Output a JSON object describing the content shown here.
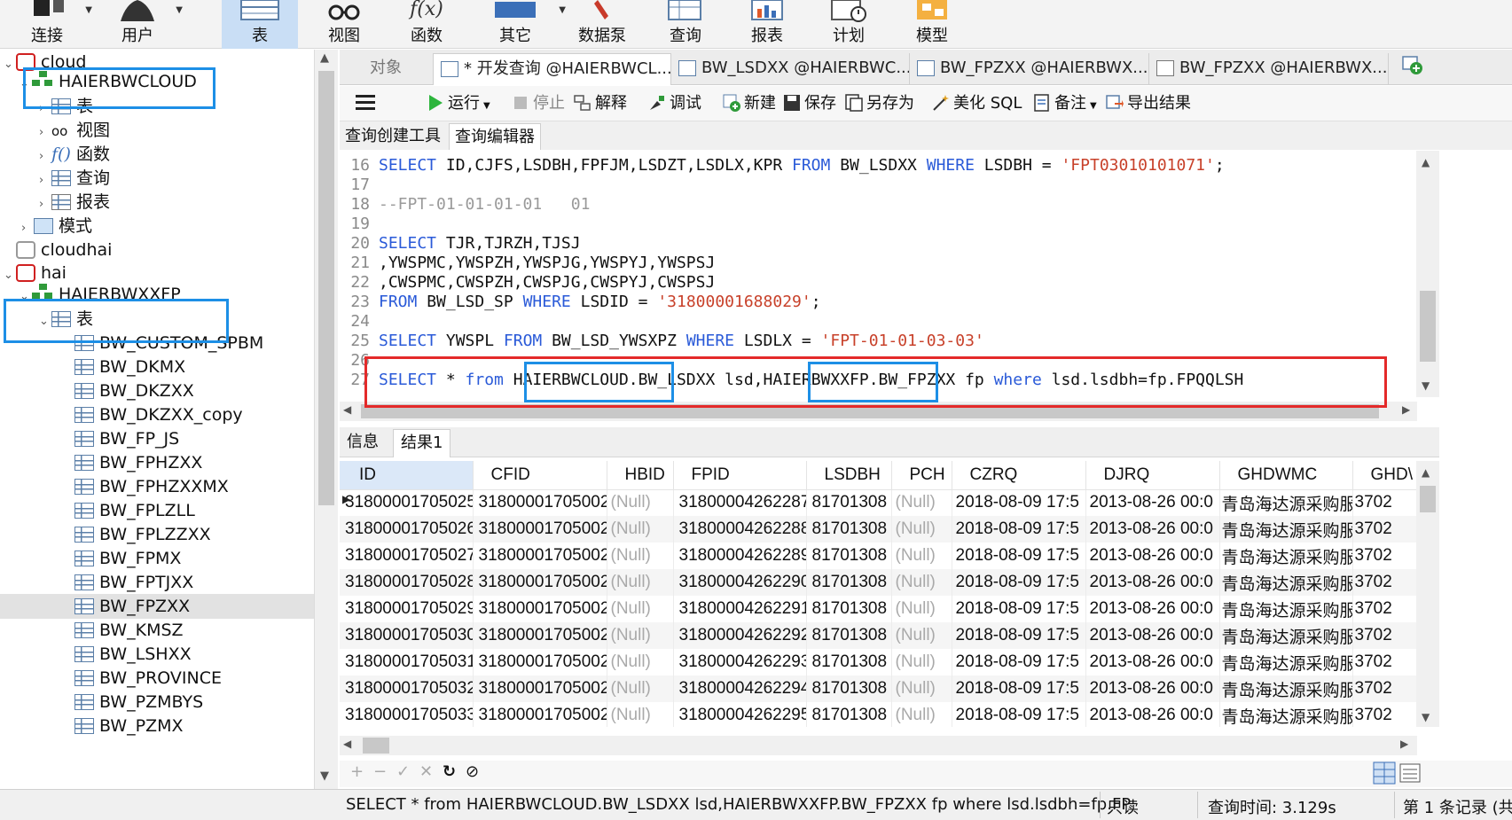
{
  "ribbon": {
    "buttons": [
      {
        "label": "连接",
        "icon": "plug-icon"
      },
      {
        "label": "用户",
        "icon": "user-icon"
      },
      {
        "label": "表",
        "icon": "table-icon"
      },
      {
        "label": "视图",
        "icon": "glasses-icon"
      },
      {
        "label": "函数",
        "icon": "function-icon"
      },
      {
        "label": "其它",
        "icon": "tools-icon"
      },
      {
        "label": "数据泵",
        "icon": "pump-icon"
      },
      {
        "label": "查询",
        "icon": "query-icon"
      },
      {
        "label": "报表",
        "icon": "report-icon"
      },
      {
        "label": "计划",
        "icon": "schedule-icon"
      },
      {
        "label": "模型",
        "icon": "model-icon"
      }
    ]
  },
  "tree": {
    "conn1": "cloud",
    "schema1": "HAIERBWCLOUD",
    "s1_items": [
      "表",
      "视图",
      "函数",
      "查询",
      "报表"
    ],
    "mode": "模式",
    "conn2": "cloudhai",
    "conn3": "hai",
    "schema2": "HAIERBWXXFP",
    "s2_table_folder": "表",
    "tables": [
      "BW_CUSTOM_SPBM",
      "BW_DKMX",
      "BW_DKZXX",
      "BW_DKZXX_copy",
      "BW_FP_JS",
      "BW_FPHZXX",
      "BW_FPHZXXMX",
      "BW_FPLZLL",
      "BW_FPLZZXX",
      "BW_FPMX",
      "BW_FPTJXX",
      "BW_FPZXX",
      "BW_KMSZ",
      "BW_LSHXX",
      "BW_PROVINCE",
      "BW_PZMBYS",
      "BW_PZMX"
    ],
    "selected_table": "BW_FPZXX"
  },
  "tabs": {
    "object": "对象",
    "items": [
      "* 开发查询 @HAIERBWCL...",
      "BW_LSDXX @HAIERBWC...",
      "BW_FPZXX @HAIERBWX...",
      "BW_FPZXX @HAIERBWX..."
    ]
  },
  "toolbar": {
    "run": "运行",
    "stop": "停止",
    "explain": "解释",
    "debug": "调试",
    "new": "新建",
    "save": "保存",
    "save_as": "另存为",
    "beautify": "美化 SQL",
    "comment": "备注",
    "export": "导出结果"
  },
  "subtabs": [
    "查询创建工具",
    "查询编辑器"
  ],
  "editor": {
    "l16": {
      "n": "16",
      "kw1": "SELECT",
      "a": " ID,CJFS,LSDBH,FPFJM,LSDZT,LSDLX,KPR ",
      "kw2": "FROM",
      "b": " BW_LSDXX ",
      "kw3": "WHERE",
      "c": " LSDBH = ",
      "s": "'FPT03010101071'",
      "d": ";"
    },
    "l17": {
      "n": "17"
    },
    "l18": {
      "n": "18",
      "cmt": "--FPT-01-01-01-01   01"
    },
    "l19": {
      "n": "19"
    },
    "l20": {
      "n": "20",
      "kw1": "SELECT",
      "a": " TJR,TJRZH,TJSJ"
    },
    "l21": {
      "n": "21",
      "a": ",YWSPMC,YWSPZH,YWSPJG,YWSPYJ,YWSPSJ"
    },
    "l22": {
      "n": "22",
      "a": ",CWSPMC,CWSPZH,CWSPJG,CWSPYJ,CWSPSJ"
    },
    "l23": {
      "n": "23",
      "kw1": "FROM",
      "a": " BW_LSD_SP ",
      "kw2": "WHERE",
      "b": " LSDID = ",
      "s": "'31800001688029'",
      "c": ";"
    },
    "l24": {
      "n": "24"
    },
    "l25": {
      "n": "25",
      "kw1": "SELECT",
      "a": " YWSPL ",
      "kw2": "FROM",
      "b": " BW_LSD_YWSXPZ ",
      "kw3": "WHERE",
      "c": " LSDLX = ",
      "s": "'FPT-01-01-03-03'"
    },
    "l26": {
      "n": "26"
    },
    "l27": {
      "n": "27",
      "kw1": "SELECT",
      "a": " * ",
      "kw2": "from",
      "b": " HAIERBWCLOUD.BW_LSDXX lsd,HAIERBWXXFP.BW_FPZXX fp ",
      "kw3": "where",
      "c": " lsd.lsdbh=fp.FPQQLSH"
    }
  },
  "result_tabs": [
    "信息",
    "结果1"
  ],
  "grid": {
    "columns": [
      "ID",
      "CFID",
      "HBID",
      "FPID",
      "LSDBH",
      "PCH",
      "CZRQ",
      "DJRQ",
      "GHDWMC",
      "GHD\\"
    ],
    "rows": [
      [
        "31800001705025",
        "31800001705002",
        "(Null)",
        "31800004262287",
        "81701308",
        "(Null)",
        "2018-08-09 17:5",
        "2013-08-26 00:0",
        "青岛海达源采购服",
        "3702"
      ],
      [
        "31800001705026",
        "31800001705002",
        "(Null)",
        "31800004262288",
        "81701308",
        "(Null)",
        "2018-08-09 17:5",
        "2013-08-26 00:0",
        "青岛海达源采购服",
        "3702"
      ],
      [
        "31800001705027",
        "31800001705002",
        "(Null)",
        "31800004262289",
        "81701308",
        "(Null)",
        "2018-08-09 17:5",
        "2013-08-26 00:0",
        "青岛海达源采购服",
        "3702"
      ],
      [
        "31800001705028",
        "31800001705002",
        "(Null)",
        "31800004262290",
        "81701308",
        "(Null)",
        "2018-08-09 17:5",
        "2013-08-26 00:0",
        "青岛海达源采购服",
        "3702"
      ],
      [
        "31800001705029",
        "31800001705002",
        "(Null)",
        "31800004262291",
        "81701308",
        "(Null)",
        "2018-08-09 17:5",
        "2013-08-26 00:0",
        "青岛海达源采购服",
        "3702"
      ],
      [
        "31800001705030",
        "31800001705002",
        "(Null)",
        "31800004262292",
        "81701308",
        "(Null)",
        "2018-08-09 17:5",
        "2013-08-26 00:0",
        "青岛海达源采购服",
        "3702"
      ],
      [
        "31800001705031",
        "31800001705002",
        "(Null)",
        "31800004262293",
        "81701308",
        "(Null)",
        "2018-08-09 17:5",
        "2013-08-26 00:0",
        "青岛海达源采购服",
        "3702"
      ],
      [
        "31800001705032",
        "31800001705002",
        "(Null)",
        "31800004262294",
        "81701308",
        "(Null)",
        "2018-08-09 17:5",
        "2013-08-26 00:0",
        "青岛海达源采购服",
        "3702"
      ],
      [
        "31800001705033",
        "31800001705002",
        "(Null)",
        "31800004262295",
        "81701308",
        "(Null)",
        "2018-08-09 17:5",
        "2013-08-26 00:0",
        "青岛海达源采购服",
        "3702"
      ]
    ]
  },
  "status": {
    "sql": "SELECT * from HAIERBWCLOUD.BW_LSDXX lsd,HAIERBWXXFP.BW_FPZXX fp where lsd.lsdbh=fp.FP",
    "readonly": "只读",
    "query_time": "查询时间: 3.129s",
    "record": "第 1 条记录 (共"
  },
  "colors": {
    "accent": "#1d8fe6",
    "highlight_red": "#e42a2a",
    "keyword": "#2a5ad8",
    "string": "#c8412a"
  }
}
